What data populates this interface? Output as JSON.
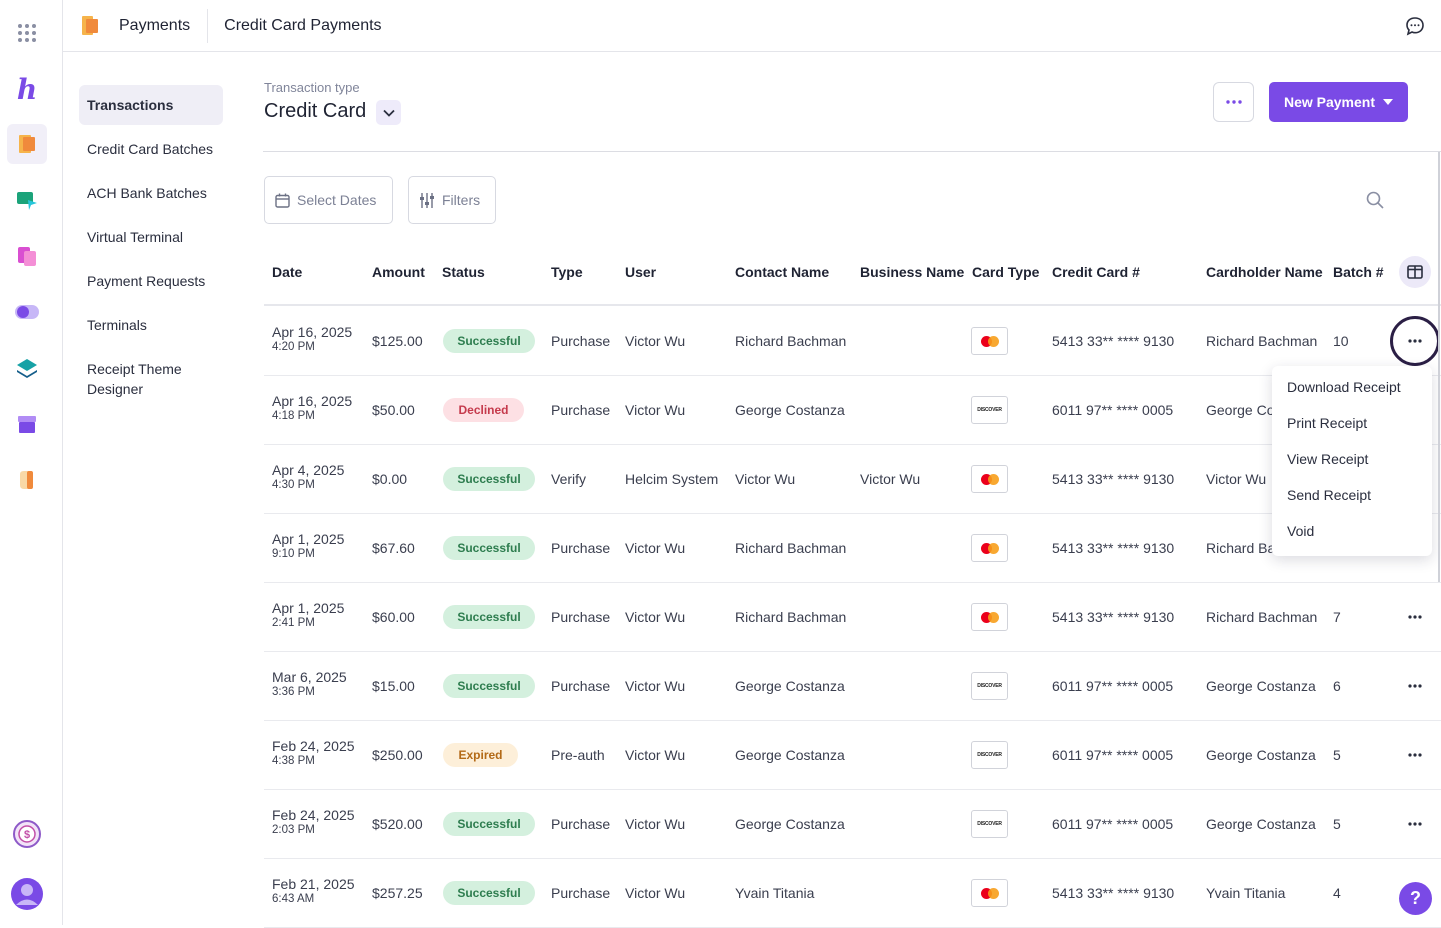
{
  "topbar": {
    "app_name": "Payments",
    "page_name": "Credit Card Payments"
  },
  "subnav": [
    {
      "label": "Transactions",
      "active": true
    },
    {
      "label": "Credit Card Batches"
    },
    {
      "label": "ACH Bank Batches"
    },
    {
      "label": "Virtual Terminal"
    },
    {
      "label": "Payment Requests"
    },
    {
      "label": "Terminals"
    },
    {
      "label": "Receipt Theme Designer"
    }
  ],
  "header": {
    "tx_type_label": "Transaction type",
    "tx_type_value": "Credit Card",
    "new_payment_label": "New Payment"
  },
  "filters": {
    "select_dates": "Select Dates",
    "filters": "Filters"
  },
  "columns": [
    "Date",
    "Amount",
    "Status",
    "Type",
    "User",
    "Contact Name",
    "Business Name",
    "Card Type",
    "Credit Card #",
    "Cardholder Name",
    "Batch #"
  ],
  "rows": [
    {
      "date": "Apr 16, 2025",
      "time": "4:20 PM",
      "amount": "$125.00",
      "status": "Successful",
      "type": "Purchase",
      "user": "Victor Wu",
      "contact": "Richard Bachman",
      "business": "",
      "card": "mastercard",
      "number": "5413 33** **** 9130",
      "holder": "Richard Bachman",
      "batch": "10"
    },
    {
      "date": "Apr 16, 2025",
      "time": "4:18 PM",
      "amount": "$50.00",
      "status": "Declined",
      "type": "Purchase",
      "user": "Victor Wu",
      "contact": "George Costanza",
      "business": "",
      "card": "discover",
      "number": "6011 97** **** 0005",
      "holder": "George Co",
      "batch": ""
    },
    {
      "date": "Apr 4, 2025",
      "time": "4:30 PM",
      "amount": "$0.00",
      "status": "Successful",
      "type": "Verify",
      "user": "Helcim System",
      "contact": "Victor Wu",
      "business": "Victor Wu",
      "card": "mastercard",
      "number": "5413 33** **** 9130",
      "holder": "Victor Wu",
      "batch": ""
    },
    {
      "date": "Apr 1, 2025",
      "time": "9:10 PM",
      "amount": "$67.60",
      "status": "Successful",
      "type": "Purchase",
      "user": "Victor Wu",
      "contact": "Richard Bachman",
      "business": "",
      "card": "mastercard",
      "number": "5413 33** **** 9130",
      "holder": "Richard Ba",
      "batch": ""
    },
    {
      "date": "Apr 1, 2025",
      "time": "2:41 PM",
      "amount": "$60.00",
      "status": "Successful",
      "type": "Purchase",
      "user": "Victor Wu",
      "contact": "Richard Bachman",
      "business": "",
      "card": "mastercard",
      "number": "5413 33** **** 9130",
      "holder": "Richard Bachman",
      "batch": "7"
    },
    {
      "date": "Mar 6, 2025",
      "time": "3:36 PM",
      "amount": "$15.00",
      "status": "Successful",
      "type": "Purchase",
      "user": "Victor Wu",
      "contact": "George Costanza",
      "business": "",
      "card": "discover",
      "number": "6011 97** **** 0005",
      "holder": "George Costanza",
      "batch": "6"
    },
    {
      "date": "Feb 24, 2025",
      "time": "4:38 PM",
      "amount": "$250.00",
      "status": "Expired",
      "type": "Pre-auth",
      "user": "Victor Wu",
      "contact": "George Costanza",
      "business": "",
      "card": "discover",
      "number": "6011 97** **** 0005",
      "holder": "George Costanza",
      "batch": "5"
    },
    {
      "date": "Feb 24, 2025",
      "time": "2:03 PM",
      "amount": "$520.00",
      "status": "Successful",
      "type": "Purchase",
      "user": "Victor Wu",
      "contact": "George Costanza",
      "business": "",
      "card": "discover",
      "number": "6011 97** **** 0005",
      "holder": "George Costanza",
      "batch": "5"
    },
    {
      "date": "Feb 21, 2025",
      "time": "6:43 AM",
      "amount": "$257.25",
      "status": "Successful",
      "type": "Purchase",
      "user": "Victor Wu",
      "contact": "Yvain Titania",
      "business": "",
      "card": "mastercard",
      "number": "5413 33** **** 9130",
      "holder": "Yvain Titania",
      "batch": "4"
    }
  ],
  "menu": [
    "Download Receipt",
    "Print Receipt",
    "View Receipt",
    "Send Receipt",
    "Void"
  ],
  "discover_label": "DISCOVER",
  "help_label": "?",
  "colors": {
    "accent": "#7a4ae6",
    "success_bg": "#d4f0de",
    "declined_bg": "#fde0e4",
    "expired_bg": "#fdefd9"
  }
}
